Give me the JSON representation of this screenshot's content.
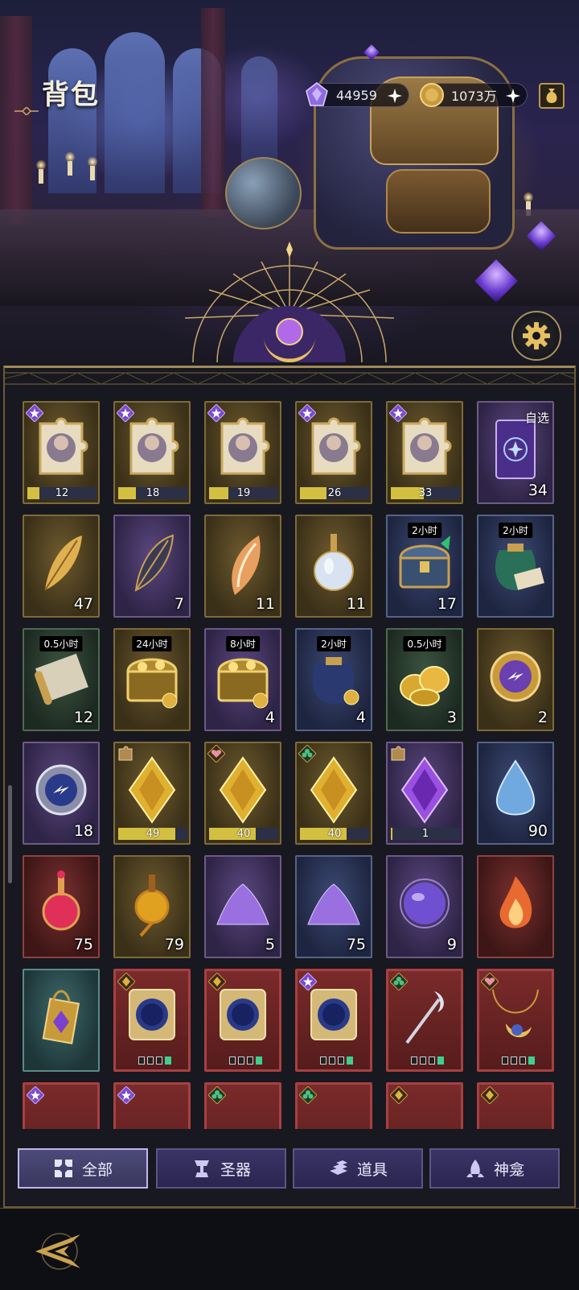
{
  "header": {
    "title": "背包",
    "crystals": "44959",
    "coins": "1073万"
  },
  "items": [
    {
      "label": "Puzzle fragment",
      "style": "gold",
      "glyph": "puzzle",
      "rank": "purple-star",
      "progress": 0.18,
      "progress_text": "12"
    },
    {
      "label": "Puzzle fragment",
      "style": "gold",
      "glyph": "puzzle",
      "rank": "purple-star",
      "progress": 0.26,
      "progress_text": "18"
    },
    {
      "label": "Puzzle fragment",
      "style": "gold",
      "glyph": "puzzle",
      "rank": "purple-star",
      "progress": 0.28,
      "progress_text": "19"
    },
    {
      "label": "Puzzle fragment",
      "style": "gold",
      "glyph": "puzzle",
      "rank": "purple-star",
      "progress": 0.38,
      "progress_text": "26"
    },
    {
      "label": "Puzzle fragment",
      "style": "gold",
      "glyph": "puzzle",
      "rank": "purple-star",
      "progress": 0.48,
      "progress_text": "33"
    },
    {
      "label": "Select card",
      "style": "purple",
      "glyph": "card",
      "tag": "自选",
      "qty": "34"
    },
    {
      "label": "Golden feather",
      "style": "gold",
      "glyph": "feather-gold",
      "qty": "47"
    },
    {
      "label": "Dark feather",
      "style": "purple",
      "glyph": "feather-dark",
      "qty": "7"
    },
    {
      "label": "Conch shell",
      "style": "gold",
      "glyph": "shell",
      "qty": "11"
    },
    {
      "label": "Potion bottle",
      "style": "gold",
      "glyph": "bottle",
      "qty": "11"
    },
    {
      "label": "Treasure chest",
      "style": "blue",
      "glyph": "chest-blue",
      "timer": "2小时",
      "qty": "17"
    },
    {
      "label": "Supply bag",
      "style": "blue",
      "glyph": "bag-green",
      "timer": "2小时",
      "qty": ""
    },
    {
      "label": "Scroll",
      "style": "green",
      "glyph": "scroll",
      "timer": "0.5小时",
      "qty": "12"
    },
    {
      "label": "Gold chest",
      "style": "gold",
      "glyph": "chest-gold",
      "timer": "24小时",
      "qty": ""
    },
    {
      "label": "Gold chest",
      "style": "purple",
      "glyph": "chest-gold",
      "timer": "8小时",
      "qty": "4"
    },
    {
      "label": "Coin bag",
      "style": "blue",
      "glyph": "bag-blue",
      "timer": "2小时",
      "qty": "4"
    },
    {
      "label": "Coin stack",
      "style": "green",
      "glyph": "coins",
      "timer": "0.5小时",
      "qty": "3"
    },
    {
      "label": "Gold medal",
      "style": "gold",
      "glyph": "medal-gold",
      "qty": "2"
    },
    {
      "label": "Silver medal",
      "style": "purple",
      "glyph": "medal-blue",
      "qty": "18"
    },
    {
      "label": "Gold crystal",
      "style": "gold",
      "glyph": "diamond-gold",
      "rank": "puzzle-gold",
      "progress": 0.82,
      "progress_text": "49"
    },
    {
      "label": "Heart crystal",
      "style": "gold",
      "glyph": "diamond-gold",
      "rank": "heart",
      "progress": 0.67,
      "progress_text": "40"
    },
    {
      "label": "Clover crystal",
      "style": "gold",
      "glyph": "diamond-gold",
      "rank": "clover",
      "progress": 0.67,
      "progress_text": "40"
    },
    {
      "label": "Purple crystal",
      "style": "purple",
      "glyph": "diamond-purple",
      "rank": "puzzle-gold",
      "progress": 0.02,
      "progress_text": "1"
    },
    {
      "label": "Water drop",
      "style": "blue",
      "glyph": "drop",
      "qty": "90"
    },
    {
      "label": "Red elixir",
      "style": "red",
      "glyph": "elixir-red",
      "qty": "75"
    },
    {
      "label": "Gold elixir",
      "style": "gold",
      "glyph": "elixir-gold",
      "qty": "79"
    },
    {
      "label": "Crystal dust",
      "style": "purple",
      "glyph": "dust",
      "qty": "5"
    },
    {
      "label": "Crystal dust",
      "style": "blue",
      "glyph": "dust",
      "qty": "75"
    },
    {
      "label": "Orb",
      "style": "purple",
      "glyph": "orb",
      "qty": "9"
    },
    {
      "label": "Flame",
      "style": "red",
      "glyph": "flame",
      "qty": ""
    },
    {
      "label": "Amulet",
      "style": "teal",
      "glyph": "amulet",
      "qty": ""
    },
    {
      "label": "Tarot card",
      "style": "cardred",
      "glyph": "tarot",
      "rank": "gold-diamond",
      "slots": 1
    },
    {
      "label": "Tarot card",
      "style": "cardred",
      "glyph": "tarot",
      "rank": "gold-diamond",
      "slots": 1
    },
    {
      "label": "Tarot card",
      "style": "cardred",
      "glyph": "tarot",
      "rank": "purple-star",
      "slots": 1
    },
    {
      "label": "Moon staff",
      "style": "cardred",
      "glyph": "staff",
      "rank": "clover",
      "slots": 1
    },
    {
      "label": "Moon necklace",
      "style": "cardred",
      "glyph": "necklace",
      "rank": "heart",
      "slots": 1
    },
    {
      "label": "Equipment",
      "style": "cardred",
      "glyph": "",
      "rank": "purple-star"
    },
    {
      "label": "Equipment",
      "style": "cardred",
      "glyph": "",
      "rank": "purple-star"
    },
    {
      "label": "Equipment",
      "style": "cardred",
      "glyph": "",
      "rank": "clover"
    },
    {
      "label": "Equipment",
      "style": "cardred",
      "glyph": "",
      "rank": "clover"
    },
    {
      "label": "Equipment",
      "style": "cardred",
      "glyph": "",
      "rank": "gold-diamond"
    },
    {
      "label": "Equipment",
      "style": "cardred",
      "glyph": "",
      "rank": "gold-diamond"
    }
  ],
  "tabs": [
    {
      "label": "全部",
      "icon": "grid-icon",
      "active": true
    },
    {
      "label": "圣器",
      "icon": "relic-icon",
      "active": false
    },
    {
      "label": "道具",
      "icon": "bars-icon",
      "active": false
    },
    {
      "label": "神龛",
      "icon": "shrine-icon",
      "active": false
    }
  ],
  "colors": {
    "accent_gold": "#b99650",
    "tab_active": "#4d4a7a",
    "panel_bg": "#181820"
  }
}
